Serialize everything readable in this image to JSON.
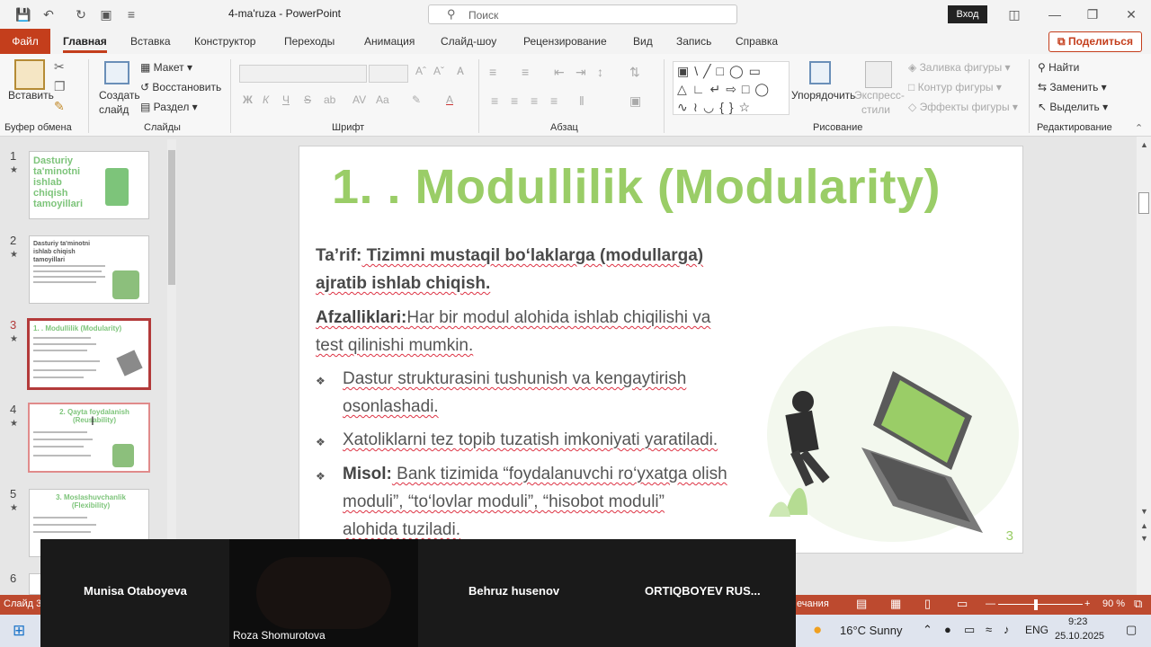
{
  "window": {
    "doc_title": "4-ma'ruza  -  PowerPoint",
    "search_placeholder": "Поиск",
    "login": "Вход"
  },
  "tabs": {
    "file": "Файл",
    "items": [
      "Главная",
      "Вставка",
      "Конструктор",
      "Переходы",
      "Анимация",
      "Слайд-шоу",
      "Рецензирование",
      "Вид",
      "Запись",
      "Справка"
    ],
    "share": "Поделиться"
  },
  "ribbon": {
    "paste": "Вставить",
    "clipboard": "Буфер обмена",
    "new_slide": "Создать",
    "new_slide2": "слайд",
    "layout": "Макет",
    "reset": "Восстановить",
    "section": "Раздел",
    "slides": "Слайды",
    "font": "Шрифт",
    "paragraph": "Абзац",
    "arrange": "Упорядочить",
    "quick_styles": "Экспресс-",
    "quick_styles2": "стили",
    "fill": "Заливка фигуры",
    "outline": "Контур фигуры",
    "effects": "Эффекты фигуры",
    "drawing": "Рисование",
    "find": "Найти",
    "replace": "Заменить",
    "select": "Выделить",
    "editing": "Редактирование"
  },
  "thumbs": [
    {
      "num": "1",
      "title": "Dasturiy ta'minotni ishlab chiqish tamoyillari"
    },
    {
      "num": "2",
      "title": "Dasturiy ta'minotni ishlab chiqish tamoyillari"
    },
    {
      "num": "3",
      "title": "1. . Modullilik (Modularity)"
    },
    {
      "num": "4",
      "title": "2. Qayta foydalanish (Reusability)"
    },
    {
      "num": "5",
      "title": "3. Moslashuvchanlik (Flexibility)"
    },
    {
      "num": "6",
      "title": ""
    }
  ],
  "slide": {
    "title": "1. . Modullilik (Modularity)",
    "def_label": "Ta’rif:",
    "def_text1": " Tizimni mustaqil bo‘laklarga (modullarga)",
    "def_text2": "ajratib ishlab chiqish.",
    "adv_label": "Afzalliklari:",
    "adv_text1": "Har bir modul alohida ishlab chiqilishi va",
    "adv_text2": "test qilinishi mumkin.",
    "b1a": "Dastur strukturasini tushunish va kengaytirish",
    "b1b": "osonlashadi.",
    "b2": "Xatoliklarni tez topib tuzatish imkoniyati yaratiladi.",
    "b3_label": "Misol:",
    "b3a": " Bank tizimida “foydalanuvchi ro‘yxatga olish",
    "b3b": "moduli”, “to‘lovlar moduli”, “hisobot moduli”",
    "b3c": "alohida tuziladi.",
    "num": "3"
  },
  "video": {
    "p1": "Munisa Otaboyeva",
    "p2": "Roza Shomurotova",
    "p3": "Behruz husenov",
    "p4": "ORTIQBOYEV  RUS..."
  },
  "status": {
    "slide": "Слайд 3",
    "notes": "ечания",
    "zoom": "90 %"
  },
  "taskbar": {
    "weather": "16°C  Sunny",
    "lang": "ENG",
    "time": "9:23",
    "date": "25.10.2025"
  }
}
